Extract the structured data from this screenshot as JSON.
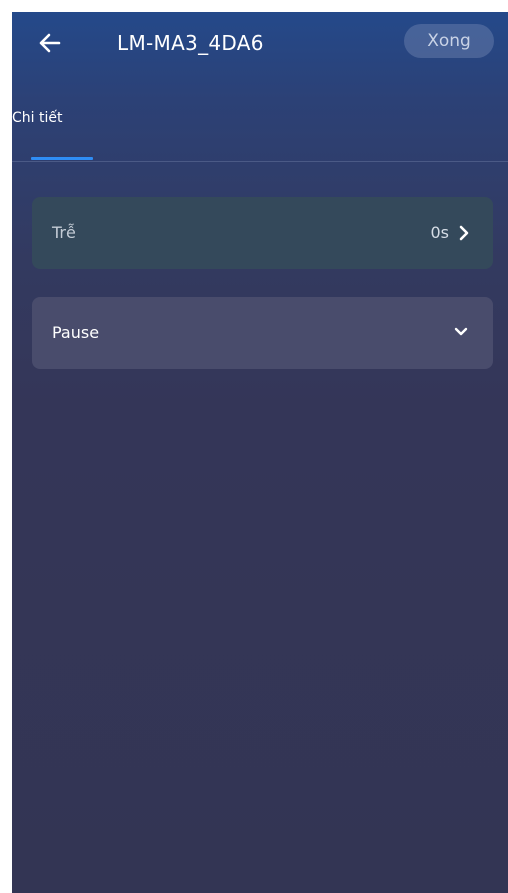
{
  "header": {
    "back_icon": "arrow-left-icon",
    "title": "LM-MA3_4DA6",
    "done_label": "Xong"
  },
  "tabs": [
    {
      "label": "Chi tiết",
      "active": true
    }
  ],
  "colors": {
    "accent": "#2f8df5",
    "background_top": "#24498a",
    "background_bottom": "#333554"
  },
  "settings": {
    "delay": {
      "label": "Trễ",
      "value": "0s",
      "icon": "chevron-right-icon"
    },
    "action": {
      "selected": "Pause",
      "icon": "chevron-down-icon"
    }
  }
}
